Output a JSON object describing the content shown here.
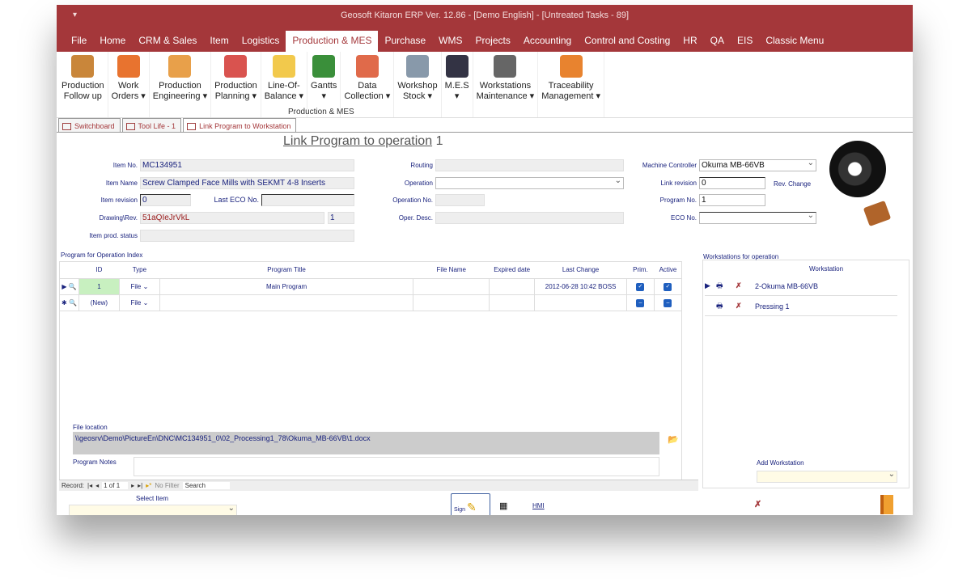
{
  "title": "Geosoft Kitaron ERP Ver. 12.86 - [Demo English] - [Untreated Tasks - 89]",
  "menu": [
    "File",
    "Home",
    "CRM & Sales",
    "Item",
    "Logistics",
    "Production & MES",
    "Purchase",
    "WMS",
    "Projects",
    "Accounting",
    "Control and Costing",
    "HR",
    "QA",
    "EIS",
    "Classic Menu"
  ],
  "active_menu": "Production & MES",
  "ribbon": {
    "group": "Production & MES",
    "buttons": [
      {
        "l1": "Production",
        "l2": "Follow up",
        "color": "#c9863a"
      },
      {
        "l1": "Work",
        "l2": "Orders ▾",
        "color": "#e8732f"
      },
      {
        "l1": "Production",
        "l2": "Engineering ▾",
        "color": "#e8a04a"
      },
      {
        "l1": "Production",
        "l2": "Planning ▾",
        "color": "#d9534f"
      },
      {
        "l1": "Line-Of-",
        "l2": "Balance ▾",
        "color": "#f2c94c"
      },
      {
        "l1": "Gantts",
        "l2": "▾",
        "color": "#3a8f3a"
      },
      {
        "l1": "Data",
        "l2": "Collection ▾",
        "color": "#e06a4a"
      },
      {
        "l1": "Workshop",
        "l2": "Stock ▾",
        "color": "#8899aa"
      },
      {
        "l1": "M.E.S",
        "l2": "▾",
        "color": "#334"
      },
      {
        "l1": "Workstations",
        "l2": "Maintenance ▾",
        "color": "#666"
      },
      {
        "l1": "Traceability",
        "l2": "Management ▾",
        "color": "#e8832f"
      }
    ]
  },
  "tabs": [
    "Switchboard",
    "Tool Life - 1",
    "Link Program to Workstation"
  ],
  "form": {
    "heading": "Link Program to operation",
    "heading_num": "1",
    "item_no_label": "Item No.",
    "item_no": "MC134951",
    "item_name_label": "Item Name",
    "item_name": "Screw Clamped Face Mills with SEKMT 4-8 Inserts",
    "item_rev_label": "Item revision",
    "item_rev": "0",
    "last_eco_label": "Last ECO No.",
    "last_eco": "",
    "drawing_label": "Drawing\\Rev.",
    "drawing": "51aQIeJrVkL",
    "drawing_rev": "1",
    "prod_status_label": "Item prod. status",
    "routing_label": "Routing",
    "operation_label": "Operation",
    "op_no_label": "Operation No.",
    "op_desc_label": "Oper. Desc.",
    "mc_label": "Machine Controller",
    "mc": "Okuma MB-66VB",
    "link_rev_label": "Link revision",
    "link_rev": "0",
    "rev_change": "Rev. Change",
    "prog_no_label": "Program No.",
    "prog_no": "1",
    "eco_label": "ECO No."
  },
  "grid": {
    "caption": "Program for Operation Index",
    "headers": [
      "ID",
      "Type",
      "Program Title",
      "File Name",
      "Expired date",
      "Last Change",
      "Prim.",
      "Active"
    ],
    "rows": [
      {
        "id": "1",
        "type": "File",
        "title": "Main Program",
        "file": "",
        "expired": "",
        "last": "2012-06-28 10:42 BOSS",
        "prim": true,
        "active": true
      },
      {
        "id": "(New)",
        "type": "File",
        "title": "",
        "file": "",
        "expired": "",
        "last": "",
        "prim": false,
        "active": false
      }
    ]
  },
  "file_location_label": "File location",
  "file_location": "\\\\geosrv\\Demo\\PictureEn\\DNC\\MC134951_0\\02_Processing1_78\\Okuma_MB-66VB\\1.docx",
  "program_notes_label": "Program Notes",
  "nav": {
    "record_label": "Record:",
    "position": "1 of 1",
    "filter": "No Filter",
    "search": "Search"
  },
  "workstations": {
    "caption": "Workstations for operation",
    "header": "Workstation",
    "items": [
      "2-Okuma MB-66VB",
      "Pressing 1"
    ],
    "add_label": "Add Workstation"
  },
  "footer": {
    "select_item": "Select Item",
    "sign": "Sign",
    "hmi": "HMI"
  }
}
